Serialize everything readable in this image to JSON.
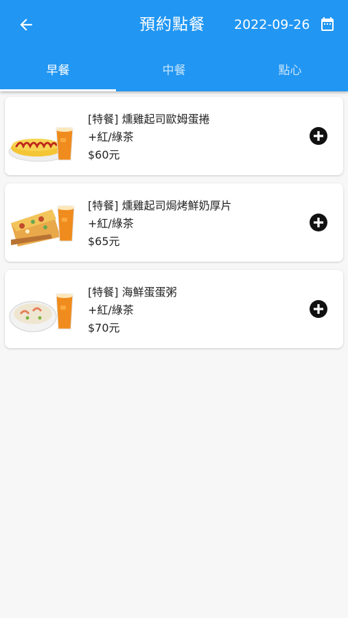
{
  "header": {
    "title": "預約點餐",
    "date": "2022-09-26",
    "background": "#2196f3"
  },
  "tabs": [
    {
      "label": "早餐",
      "selected": true
    },
    {
      "label": "中餐",
      "selected": false
    },
    {
      "label": "點心",
      "selected": false
    }
  ],
  "menu_items": [
    {
      "title": "[特餐] 燻雞起司歐姆蛋捲",
      "drink": "+紅/綠茶",
      "price": "$60元",
      "image": "omelette-with-tea"
    },
    {
      "title": "[特餐] 燻雞起司焗烤鮮奶厚片",
      "drink": "+紅/綠茶",
      "price": "$65元",
      "image": "baked-toast-with-tea"
    },
    {
      "title": "[特餐] 海鮮蛋蛋粥",
      "drink": "+紅/綠茶",
      "price": "$70元",
      "image": "seafood-congee-with-tea"
    }
  ]
}
